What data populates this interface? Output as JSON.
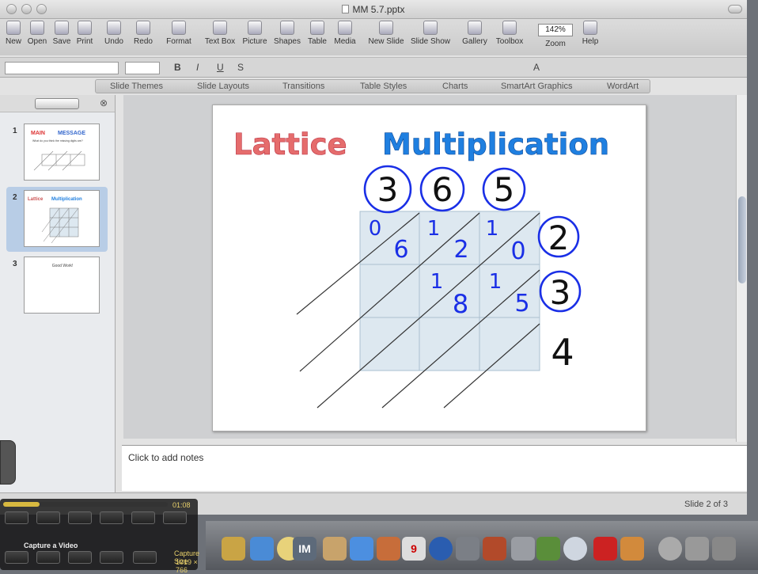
{
  "window": {
    "title": "MM 5.7.pptx"
  },
  "toolbar": {
    "items": [
      {
        "label": "New"
      },
      {
        "label": "Open"
      },
      {
        "label": "Save"
      },
      {
        "label": "Print"
      },
      {
        "label": "Undo"
      },
      {
        "label": "Redo"
      },
      {
        "label": "Format"
      },
      {
        "label": "Text Box"
      },
      {
        "label": "Picture"
      },
      {
        "label": "Shapes"
      },
      {
        "label": "Table"
      },
      {
        "label": "Media"
      },
      {
        "label": "New Slide"
      },
      {
        "label": "Slide Show"
      },
      {
        "label": "Gallery"
      },
      {
        "label": "Toolbox"
      },
      {
        "label": "Zoom"
      },
      {
        "label": "Help"
      }
    ],
    "zoom_value": "142%"
  },
  "format_bar": {
    "bold": "B",
    "italic": "I",
    "underline": "U",
    "shadow": "S",
    "font_color": "A"
  },
  "ribbon": {
    "tabs": [
      "Slide Themes",
      "Slide Layouts",
      "Transitions",
      "Table Styles",
      "Charts",
      "SmartArt Graphics",
      "WordArt"
    ]
  },
  "slides": [
    {
      "number": "1",
      "title_a": "MAIN",
      "title_b": "MESSAGE",
      "subtitle": "What do you think the missing digits are?"
    },
    {
      "number": "2",
      "title_a": "Lattice",
      "title_b": "Multiplication"
    },
    {
      "number": "3",
      "text": "Good Work!"
    }
  ],
  "slide": {
    "title_part1": "Lattice",
    "title_part2": "Multiplication",
    "top_digits": [
      "3",
      "6",
      "5"
    ],
    "side_digits": [
      "2",
      "3"
    ],
    "side_pending": "4",
    "cells": [
      {
        "tens": "0",
        "ones": "6"
      },
      {
        "tens": "1",
        "ones": "2"
      },
      {
        "tens": "1",
        "ones": "0"
      },
      {
        "tens": "1",
        "ones": "8"
      },
      {
        "tens": "1",
        "ones": "5"
      }
    ],
    "colors": {
      "digit": "#1a2fe6",
      "ink": "#111111",
      "grid_fill": "#dde8f0",
      "title_blue": "#1f7fe0"
    }
  },
  "notes": {
    "placeholder": "Click to add notes"
  },
  "status": {
    "slide_indicator": "Slide 2 of 3"
  },
  "capture": {
    "label": "Capture a Video",
    "elapsed": "01:08",
    "size_label": "Capture Size",
    "size_value": "1019 × 766"
  },
  "dock": {
    "items": [
      "IM",
      "9"
    ]
  }
}
